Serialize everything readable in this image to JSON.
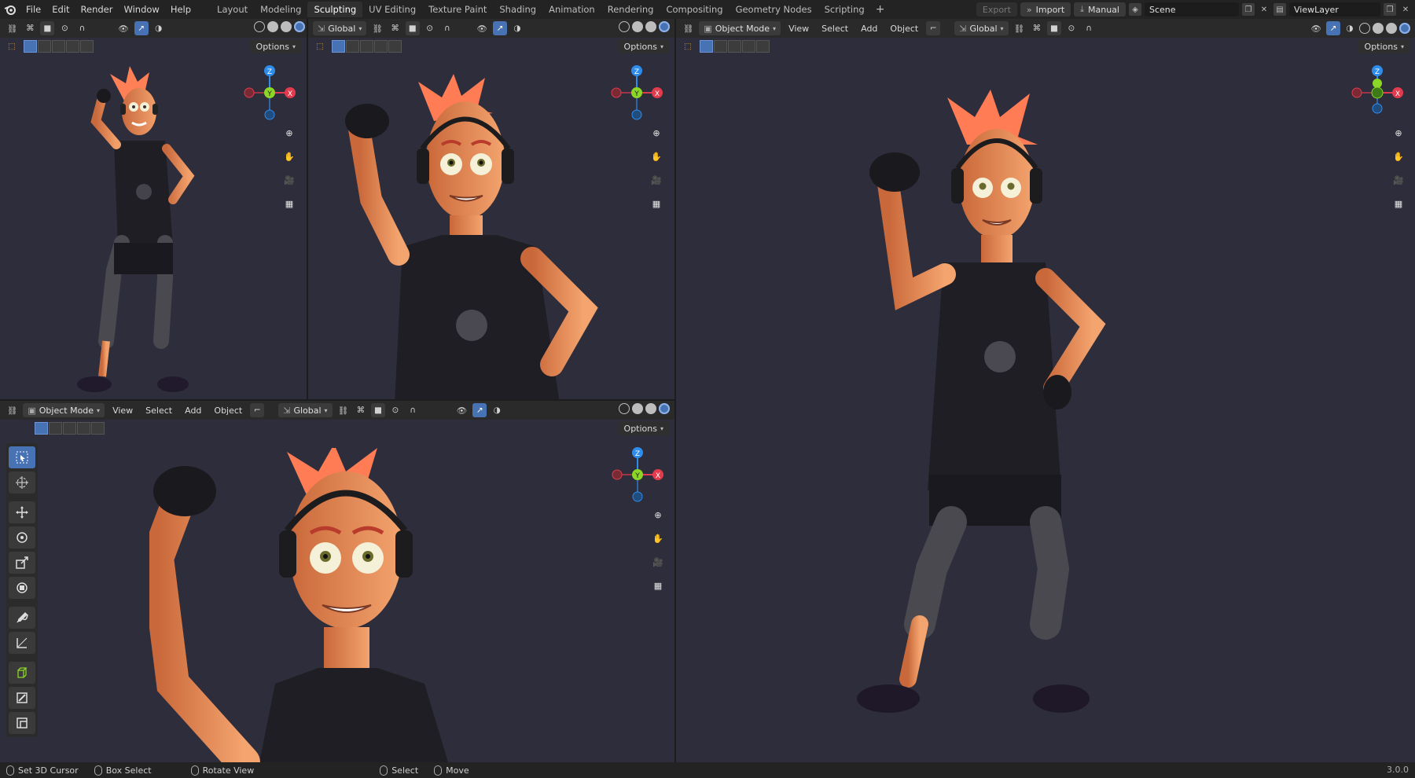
{
  "menus": [
    "File",
    "Edit",
    "Render",
    "Window",
    "Help"
  ],
  "workspaces": [
    "Layout",
    "Modeling",
    "Sculpting",
    "UV Editing",
    "Texture Paint",
    "Shading",
    "Animation",
    "Rendering",
    "Compositing",
    "Geometry Nodes",
    "Scripting"
  ],
  "active_workspace": "Sculpting",
  "add_workspace": "+",
  "topright": {
    "export": "Export",
    "import": "Import",
    "manual": "Manual",
    "scene": "Scene",
    "view_layer": "ViewLayer"
  },
  "viewport": {
    "mode": "Object Mode",
    "menu": [
      "View",
      "Select",
      "Add",
      "Object"
    ],
    "orientation": "Global",
    "options": "Options",
    "gizmo": {
      "x": "X",
      "y": "Y",
      "z": "Z"
    }
  },
  "colors": {
    "accent": "#4772b3",
    "axis_x": "#e23b4d",
    "axis_y": "#8bd627",
    "axis_z": "#2e8ceb",
    "viewport_bg": "#2e2d3b"
  },
  "tools": [
    "select-box",
    "cursor",
    "move",
    "rotate",
    "scale",
    "transform",
    "annotate",
    "measure",
    "add-cube",
    "extrude",
    "inset"
  ],
  "statusbar": {
    "set_cursor": "Set 3D Cursor",
    "box_select": "Box Select",
    "rotate_view": "Rotate View",
    "select": "Select",
    "move": "Move",
    "version": "3.0.0"
  }
}
